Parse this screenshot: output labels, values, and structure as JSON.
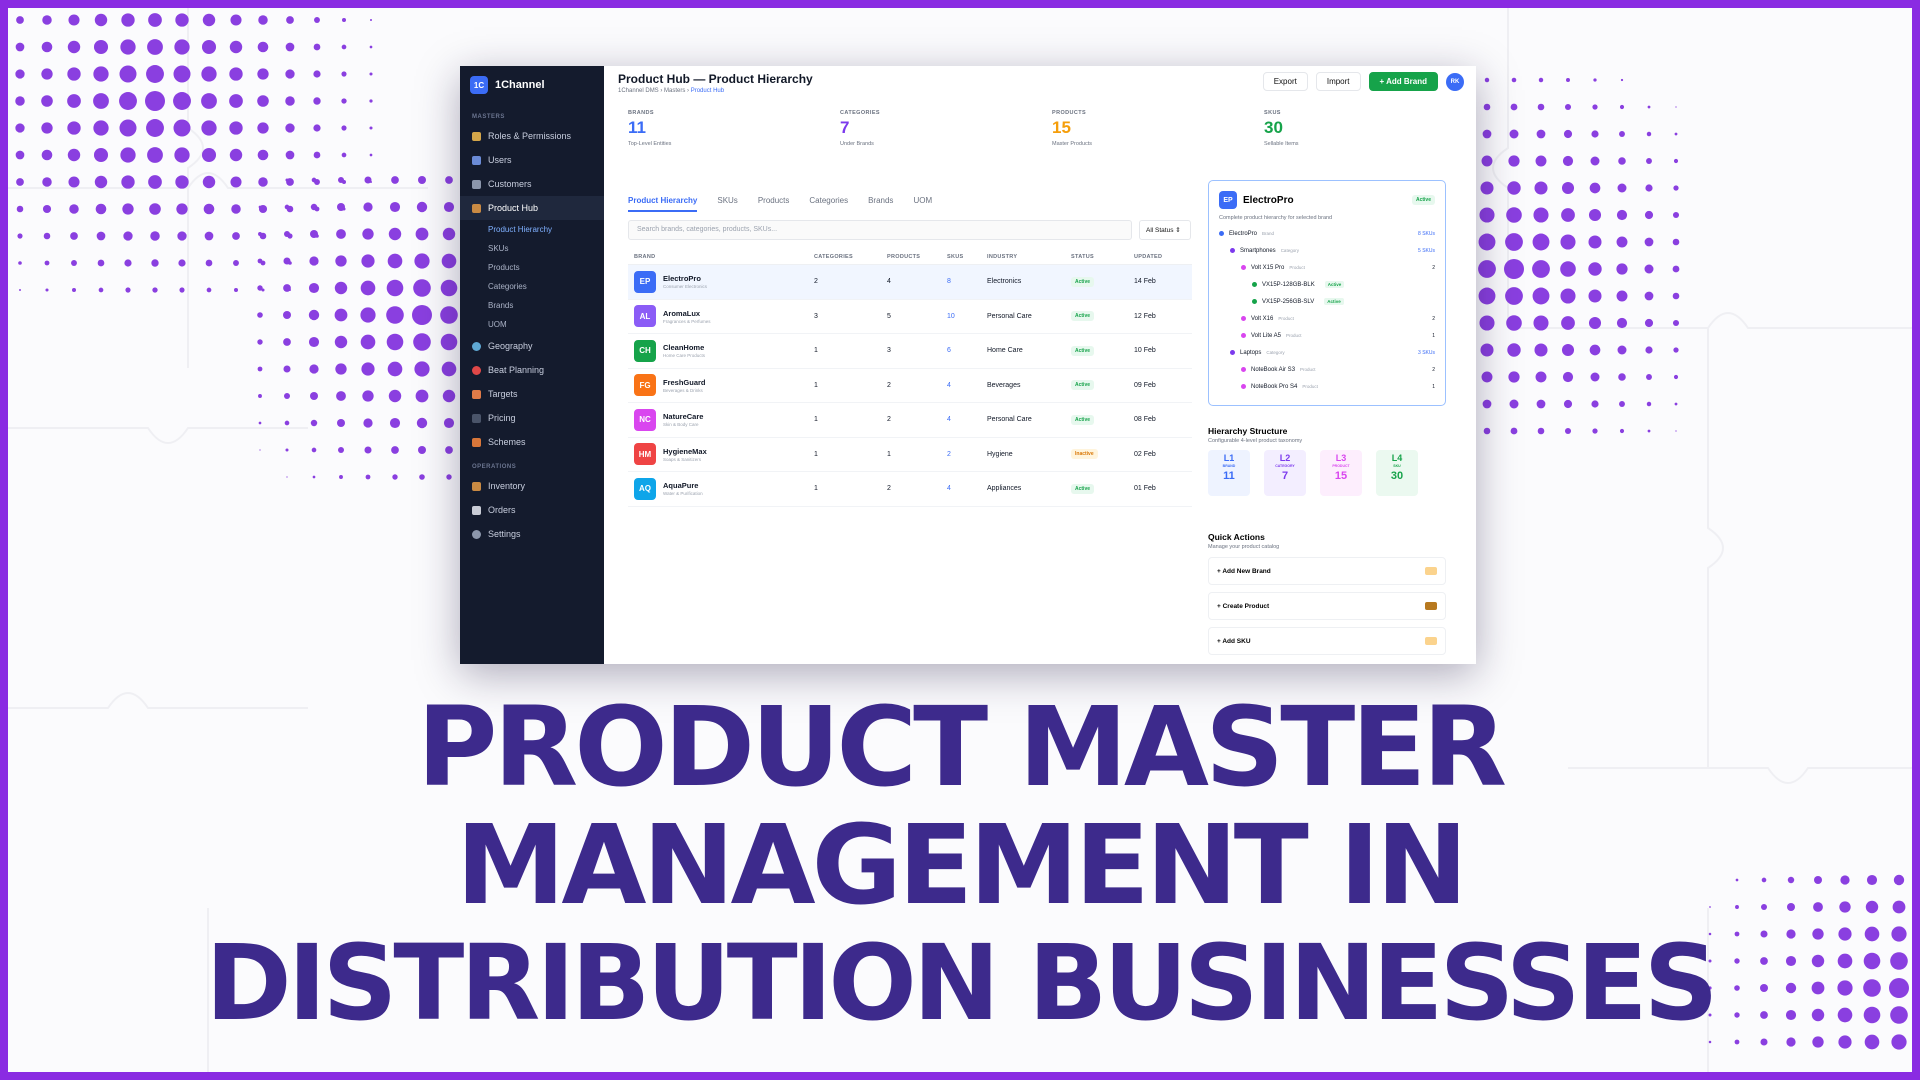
{
  "app": {
    "logo": "1C",
    "name": "1Channel",
    "title": "Product Hub — Product Hierarchy",
    "breadcrumb": {
      "root": "1Channel DMS",
      "mid": "Masters",
      "current": "Product Hub"
    },
    "sep": "›"
  },
  "actions": {
    "export": "Export",
    "import": "Import",
    "add_brand": "+ Add Brand",
    "user_initials": "RK"
  },
  "sidebar": {
    "masters_label": "MASTERS",
    "masters": [
      {
        "label": "Roles & Permissions",
        "icon": "key-icon"
      },
      {
        "label": "Users",
        "icon": "users-icon"
      },
      {
        "label": "Customers",
        "icon": "customers-icon"
      },
      {
        "label": "Product Hub",
        "icon": "box-icon"
      }
    ],
    "subitems": [
      "Product Hierarchy",
      "SKUs",
      "Products",
      "Categories",
      "Brands",
      "UOM"
    ],
    "more": [
      {
        "label": "Geography",
        "icon": "globe-icon"
      },
      {
        "label": "Beat Planning",
        "icon": "pin-icon"
      },
      {
        "label": "Targets",
        "icon": "target-icon"
      },
      {
        "label": "Pricing",
        "icon": "dollar-icon"
      },
      {
        "label": "Schemes",
        "icon": "gift-icon"
      }
    ],
    "operations_label": "OPERATIONS",
    "operations": [
      {
        "label": "Inventory",
        "icon": "inventory-icon"
      },
      {
        "label": "Orders",
        "icon": "orders-icon"
      },
      {
        "label": "Settings",
        "icon": "gear-icon"
      }
    ]
  },
  "stats": [
    {
      "label": "BRANDS",
      "value": "11",
      "sub": "Top-Level Entities",
      "color": "#3b6cf6"
    },
    {
      "label": "CATEGORIES",
      "value": "7",
      "sub": "Under Brands",
      "color": "#7c3aed"
    },
    {
      "label": "PRODUCTS",
      "value": "15",
      "sub": "Master Products",
      "color": "#f59e0b"
    },
    {
      "label": "SKUS",
      "value": "30",
      "sub": "Sellable Items",
      "color": "#16a34a"
    }
  ],
  "tabs": [
    "Product Hierarchy",
    "SKUs",
    "Products",
    "Categories",
    "Brands",
    "UOM"
  ],
  "search_placeholder": "Search brands, categories, products, SKUs...",
  "filter": "All Status ⇕",
  "table": {
    "headers": [
      "BRAND",
      "CATEGORIES",
      "PRODUCTS",
      "SKUS",
      "INDUSTRY",
      "STATUS",
      "UPDATED"
    ],
    "rows": [
      {
        "code": "EP",
        "name": "ElectroPro",
        "sub": "Consumer Electronics",
        "color": "#3b6cf6",
        "categories": "2",
        "products": "4",
        "skus": "8",
        "industry": "Electronics",
        "status": "Active",
        "updated": "14 Feb"
      },
      {
        "code": "AL",
        "name": "AromaLux",
        "sub": "Fragrances & Perfumes",
        "color": "#8b5cf6",
        "categories": "3",
        "products": "5",
        "skus": "10",
        "industry": "Personal Care",
        "status": "Active",
        "updated": "12 Feb"
      },
      {
        "code": "CH",
        "name": "CleanHome",
        "sub": "Home Care Products",
        "color": "#16a34a",
        "categories": "1",
        "products": "3",
        "skus": "6",
        "industry": "Home Care",
        "status": "Active",
        "updated": "10 Feb"
      },
      {
        "code": "FG",
        "name": "FreshGuard",
        "sub": "Beverages & Drinks",
        "color": "#f97316",
        "categories": "1",
        "products": "2",
        "skus": "4",
        "industry": "Beverages",
        "status": "Active",
        "updated": "09 Feb"
      },
      {
        "code": "NC",
        "name": "NatureCare",
        "sub": "Skin & Body Care",
        "color": "#d946ef",
        "categories": "1",
        "products": "2",
        "skus": "4",
        "industry": "Personal Care",
        "status": "Active",
        "updated": "08 Feb"
      },
      {
        "code": "HM",
        "name": "HygieneMax",
        "sub": "Soaps & Sanitizers",
        "color": "#ef4444",
        "categories": "1",
        "products": "1",
        "skus": "2",
        "industry": "Hygiene",
        "status": "Inactive",
        "updated": "02 Feb"
      },
      {
        "code": "AQ",
        "name": "AquaPure",
        "sub": "Water & Purification",
        "color": "#0ea5e9",
        "categories": "1",
        "products": "2",
        "skus": "4",
        "industry": "Appliances",
        "status": "Active",
        "updated": "01 Feb"
      }
    ]
  },
  "detail": {
    "code": "EP",
    "name": "ElectroPro",
    "status": "Active",
    "subtitle": "Complete product hierarchy for selected brand",
    "tree": [
      {
        "label": "ElectroPro",
        "tag": "Brand",
        "count": "8 SKUs",
        "level": 0,
        "dot": "#3b6cf6",
        "countclass": ""
      },
      {
        "label": "Smartphones",
        "tag": "Category",
        "count": "5 SKUs",
        "level": 1,
        "dot": "#7c3aed",
        "countclass": ""
      },
      {
        "label": "Volt X15 Pro",
        "tag": "Product",
        "count": "2",
        "level": 2,
        "dot": "#d946ef",
        "countclass": "dark"
      },
      {
        "label": "VX15P-128GB-BLK",
        "tag": "",
        "badge": "Active",
        "level": 3,
        "dot": "#16a34a"
      },
      {
        "label": "VX15P-256GB-SLV",
        "tag": "",
        "badge": "Active",
        "level": 3,
        "dot": "#16a34a"
      },
      {
        "label": "Volt X16",
        "tag": "Product",
        "count": "2",
        "level": 2,
        "dot": "#d946ef",
        "countclass": "dark"
      },
      {
        "label": "Volt Lite A5",
        "tag": "Product",
        "count": "1",
        "level": 2,
        "dot": "#d946ef",
        "countclass": "dark"
      },
      {
        "label": "Laptops",
        "tag": "Category",
        "count": "3 SKUs",
        "level": 1,
        "dot": "#7c3aed",
        "countclass": ""
      },
      {
        "label": "NoteBook Air S3",
        "tag": "Product",
        "count": "2",
        "level": 2,
        "dot": "#d946ef",
        "countclass": "dark"
      },
      {
        "label": "NoteBook Pro S4",
        "tag": "Product",
        "count": "1",
        "level": 2,
        "dot": "#d946ef",
        "countclass": "dark"
      }
    ]
  },
  "hierarchy": {
    "title": "Hierarchy Structure",
    "subtitle": "Configurable 4-level product taxonomy",
    "levels": [
      {
        "code": "L1",
        "name": "BRAND",
        "value": "11",
        "color": "#3b6cf6",
        "bg": "#eef3ff"
      },
      {
        "code": "L2",
        "name": "CATEGORY",
        "value": "7",
        "color": "#7c3aed",
        "bg": "#f3eeff"
      },
      {
        "code": "L3",
        "name": "PRODUCT",
        "value": "15",
        "color": "#d946ef",
        "bg": "#fdeefd"
      },
      {
        "code": "L4",
        "name": "SKU",
        "value": "30",
        "color": "#16a34a",
        "bg": "#ebf9f0"
      }
    ]
  },
  "quick_actions": {
    "title": "Quick Actions",
    "subtitle": "Manage your product catalog",
    "items": [
      {
        "label": "+ Add New Brand",
        "icon": "tag-icon",
        "color": "#fbd38d"
      },
      {
        "label": "+ Create Product",
        "icon": "package-icon",
        "color": "#b7791f"
      },
      {
        "label": "+ Add SKU",
        "icon": "barcode-icon",
        "color": "#fbd38d"
      }
    ]
  },
  "headline": [
    "PRODUCT MASTER",
    "MANAGEMENT IN",
    "DISTRIBUTION BUSINESSES"
  ]
}
